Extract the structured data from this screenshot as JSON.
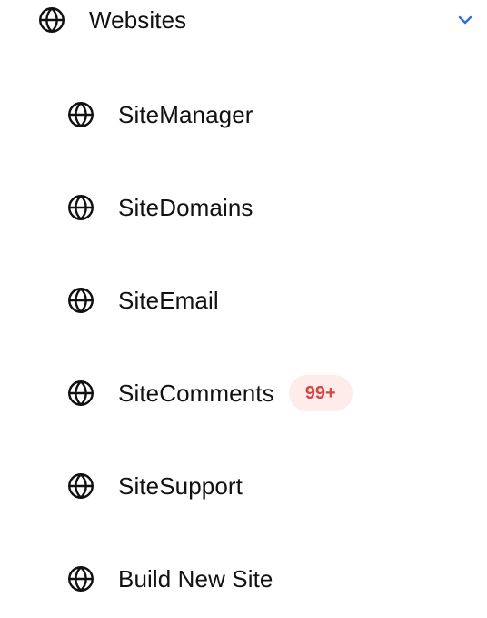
{
  "nav": {
    "parent": {
      "label": "Websites",
      "icon": "globe-icon",
      "chevron": "chevron-down-icon",
      "accent": "#2f6fe0"
    },
    "children": [
      {
        "label": "SiteManager",
        "icon": "globe-icon"
      },
      {
        "label": "SiteDomains",
        "icon": "globe-icon"
      },
      {
        "label": "SiteEmail",
        "icon": "globe-icon"
      },
      {
        "label": "SiteComments",
        "icon": "globe-icon",
        "badge": "99+"
      },
      {
        "label": "SiteSupport",
        "icon": "globe-icon"
      },
      {
        "label": "Build New Site",
        "icon": "globe-icon"
      }
    ]
  },
  "colors": {
    "text": "#111111",
    "badge_bg": "#fdecea",
    "badge_text": "#d64545",
    "chevron": "#2f6fe0"
  }
}
